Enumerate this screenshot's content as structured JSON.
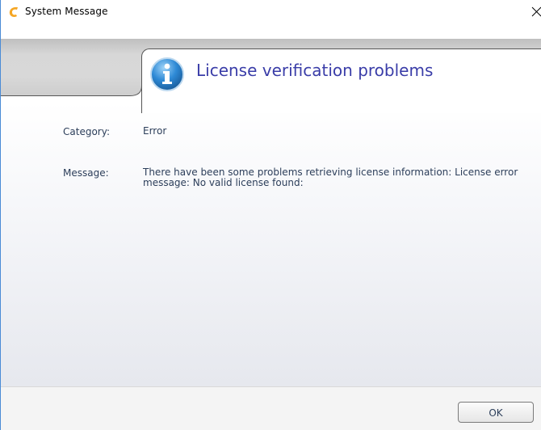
{
  "window": {
    "title": "System Message"
  },
  "header": {
    "title": "License verification problems",
    "icon": "info-icon"
  },
  "details": {
    "category_label": "Category:",
    "category_value": "Error",
    "message_label": "Message:",
    "message_value": "There have been some problems retrieving license information: License error message: No valid license found:"
  },
  "footer": {
    "ok_label": "OK"
  },
  "colors": {
    "title_accent": "#3a3da8",
    "text": "#2c3e5a",
    "window_border": "#4a8bd6",
    "app_icon": "#f5a623"
  }
}
